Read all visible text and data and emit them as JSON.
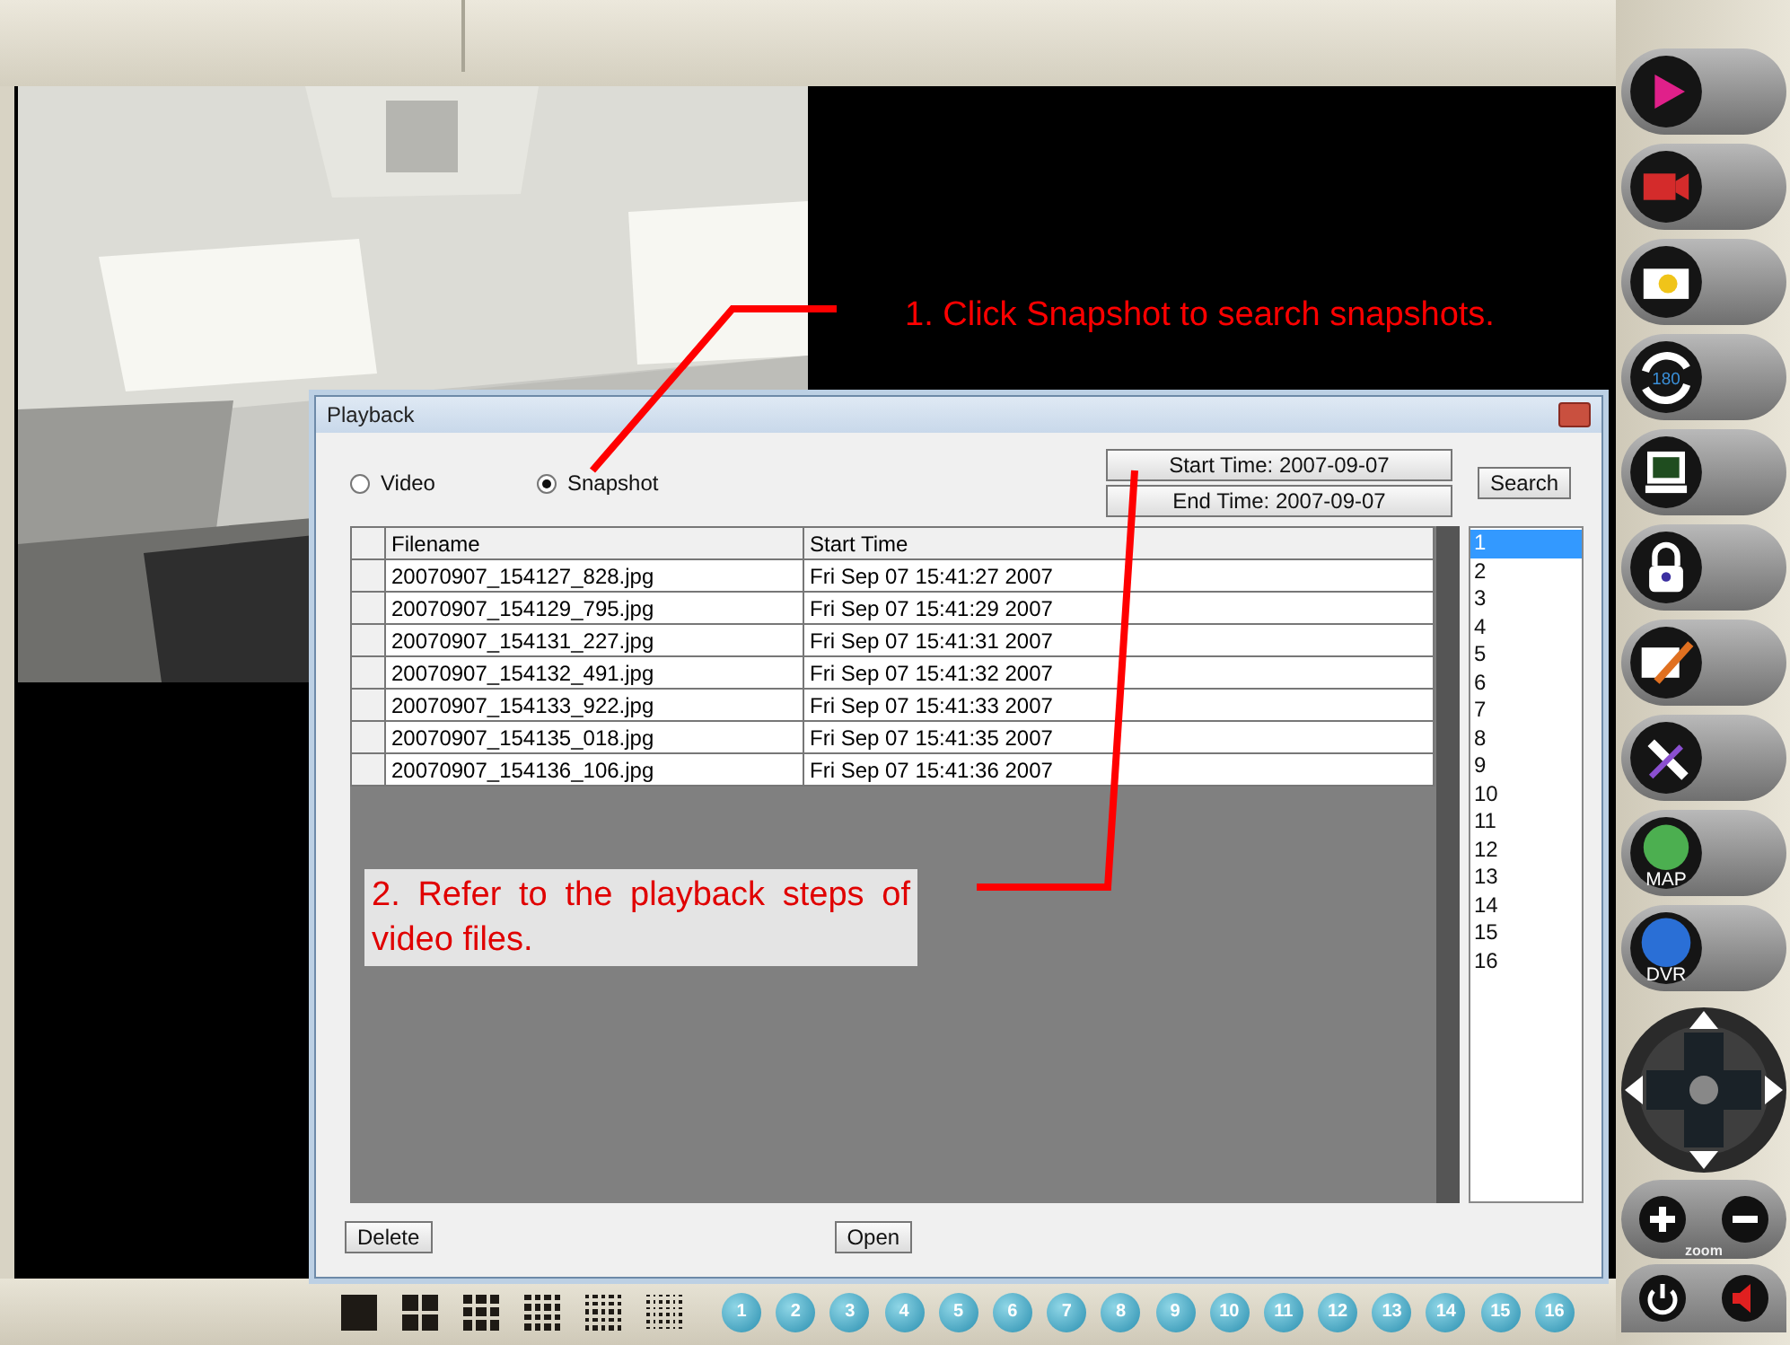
{
  "sidebar": {
    "buttons": [
      {
        "kind": "play"
      },
      {
        "kind": "record"
      },
      {
        "kind": "snapshot"
      },
      {
        "kind": "rotate",
        "label": "180"
      },
      {
        "kind": "fullscreen"
      },
      {
        "kind": "lock"
      },
      {
        "kind": "edit"
      },
      {
        "kind": "tools"
      },
      {
        "kind": "map",
        "label": "MAP"
      },
      {
        "kind": "dvr",
        "label": "DVR"
      }
    ],
    "zoom_label": "zoom"
  },
  "bottom_bar": {
    "layouts": [
      {
        "kind": "single"
      },
      {
        "kind": "quad"
      },
      {
        "kind": "six"
      },
      {
        "kind": "nine"
      },
      {
        "kind": "thirteen"
      },
      {
        "kind": "sixteen"
      }
    ],
    "channels": [
      "1",
      "2",
      "3",
      "4",
      "5",
      "6",
      "7",
      "8",
      "9",
      "10",
      "11",
      "12",
      "13",
      "14",
      "15",
      "16"
    ]
  },
  "dialog": {
    "title": "Playback",
    "radios": [
      {
        "label": "Video",
        "selected": false
      },
      {
        "label": "Snapshot",
        "selected": true
      }
    ],
    "start_time": "Start Time: 2007-09-07",
    "end_time": "End Time: 2007-09-07",
    "search": "Search",
    "table": {
      "columns": [
        "Filename",
        "Start Time"
      ],
      "rows": [
        [
          "20070907_154127_828.jpg",
          "Fri Sep 07 15:41:27 2007"
        ],
        [
          "20070907_154129_795.jpg",
          "Fri Sep 07 15:41:29 2007"
        ],
        [
          "20070907_154131_227.jpg",
          "Fri Sep 07 15:41:31 2007"
        ],
        [
          "20070907_154132_491.jpg",
          "Fri Sep 07 15:41:32 2007"
        ],
        [
          "20070907_154133_922.jpg",
          "Fri Sep 07 15:41:33 2007"
        ],
        [
          "20070907_154135_018.jpg",
          "Fri Sep 07 15:41:35 2007"
        ],
        [
          "20070907_154136_106.jpg",
          "Fri Sep 07 15:41:36 2007"
        ]
      ]
    },
    "list": [
      {
        "label": "1",
        "selected": true
      },
      {
        "label": "2",
        "selected": false
      },
      {
        "label": "3",
        "selected": false
      },
      {
        "label": "4",
        "selected": false
      },
      {
        "label": "5",
        "selected": false
      },
      {
        "label": "6",
        "selected": false
      },
      {
        "label": "7",
        "selected": false
      },
      {
        "label": "8",
        "selected": false
      },
      {
        "label": "9",
        "selected": false
      },
      {
        "label": "10",
        "selected": false
      },
      {
        "label": "11",
        "selected": false
      },
      {
        "label": "12",
        "selected": false
      },
      {
        "label": "13",
        "selected": false
      },
      {
        "label": "14",
        "selected": false
      },
      {
        "label": "15",
        "selected": false
      },
      {
        "label": "16",
        "selected": false
      }
    ],
    "buttons": [
      "Delete",
      "Open"
    ]
  },
  "annotations": [
    "1. Click Snapshot to search snapshots.",
    "2. Refer to the playback steps of video files."
  ]
}
